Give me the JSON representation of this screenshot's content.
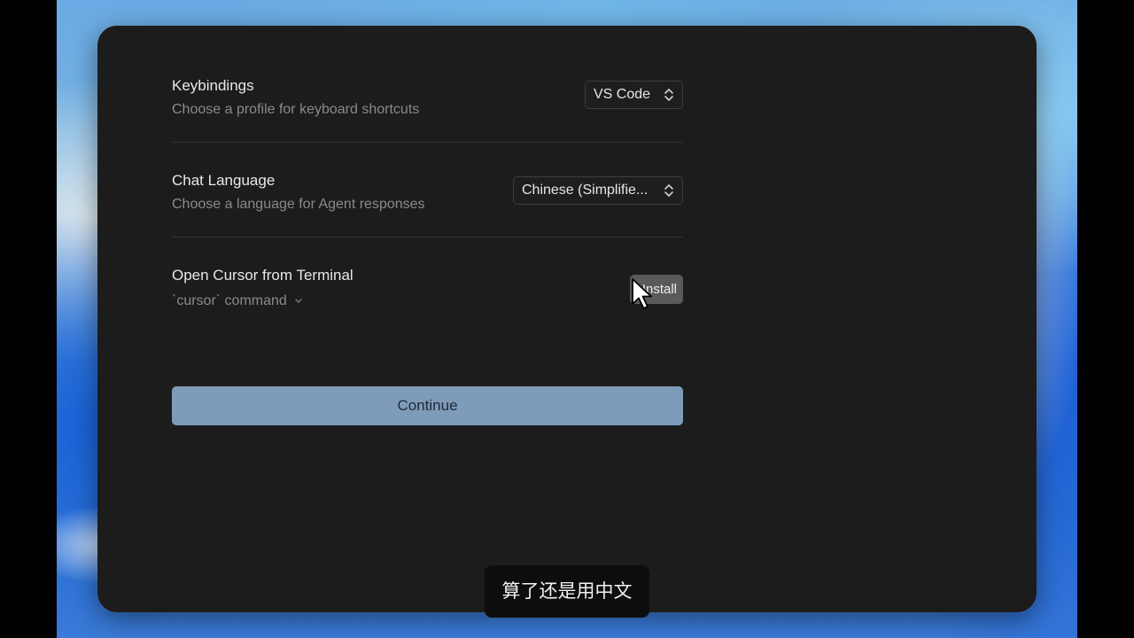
{
  "settings": {
    "keybindings": {
      "title": "Keybindings",
      "description": "Choose a profile for keyboard shortcuts",
      "selected": "VS Code"
    },
    "chat_language": {
      "title": "Chat Language",
      "description": "Choose a language for Agent responses",
      "selected": "Chinese (Simplifie..."
    },
    "terminal": {
      "title": "Open Cursor from Terminal",
      "command_label": "`cursor` command",
      "install_label": "Install"
    }
  },
  "continue_label": "Continue",
  "subtitle": "算了还是用中文",
  "icons": {
    "select_chevron": "chevron-up-down-icon",
    "expand": "chevron-down-icon",
    "pointer": "mouse-pointer-icon"
  },
  "colors": {
    "dialog_bg": "#1c1c1c",
    "continue_bg": "#7f9bba",
    "install_bg": "#5a5a5a"
  }
}
